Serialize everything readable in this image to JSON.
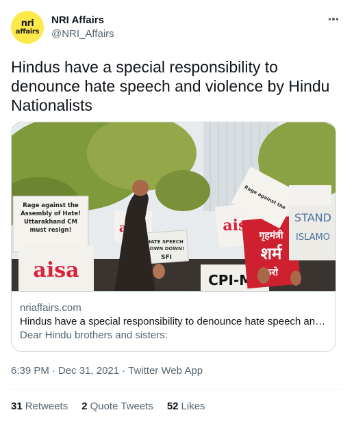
{
  "author": {
    "avatar_text_line1": "nri",
    "avatar_text_line2": "affairs",
    "display_name": "NRI Affairs",
    "handle": "@NRI_Affairs"
  },
  "tweet": {
    "text": "Hindus have a special responsibility to denounce hate speech and violence by Hindu Nationalists"
  },
  "link_card": {
    "domain": "nriaffairs.com",
    "title": "Hindus have a special responsibility to denounce hate speech an…",
    "description": "Dear Hindu brothers and sisters:",
    "image_signs": {
      "rage_sign": [
        "Rage against the",
        "Assembly of Hate!",
        "Uttarakhand CM",
        "must resign!"
      ],
      "aisa_label": "aisa",
      "stop_sign": [
        "HATE SPEECH",
        "DOWN DOWN!"
      ],
      "sfi_label": "SFI",
      "cpi_label": "CPI-ML",
      "stand_label": "STAND",
      "islam_label": "ISLAMO",
      "hindi_sign_line1": "गृहमंत्री",
      "hindi_sign_line2": "शर्म",
      "hindi_sign_line3": "करो"
    }
  },
  "meta": {
    "time": "6:39 PM",
    "separator": "·",
    "date": "Dec 31, 2021",
    "source": "Twitter Web App"
  },
  "stats": {
    "retweets_count": "31",
    "retweets_label": "Retweets",
    "quotes_count": "2",
    "quotes_label": "Quote Tweets",
    "likes_count": "52",
    "likes_label": "Likes"
  },
  "colors": {
    "text_primary": "#0f1419",
    "text_secondary": "#536471",
    "border": "#cfd9de",
    "avatar_bg": "#fde94a"
  },
  "icons": {
    "more": "more-horizontal-icon"
  }
}
